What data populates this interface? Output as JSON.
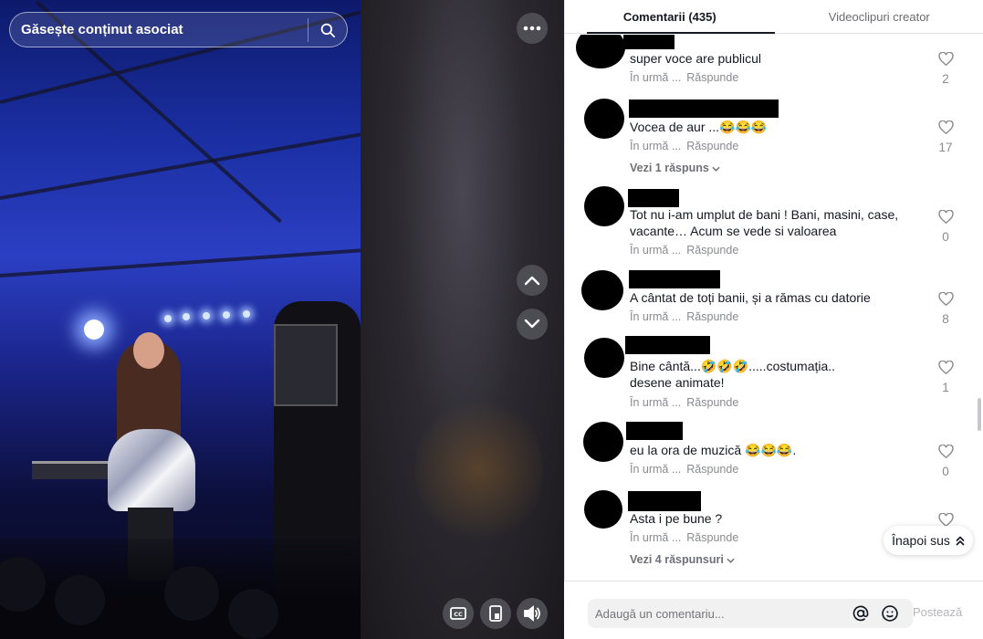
{
  "search": {
    "placeholder": "Găsește conținut asociat",
    "icon": "search-icon"
  },
  "video_controls": {
    "more_icon": "more-horizontal-icon",
    "previous_icon": "chevron-up-icon",
    "next_icon": "chevron-down-icon",
    "captions_icon": "captions-icon",
    "miniplayer_icon": "floating-player-icon",
    "volume_icon": "volume-icon"
  },
  "tabs": {
    "comments": "Comentarii (435)",
    "creator_videos": "Videoclipuri creator"
  },
  "comments": [
    {
      "text": "super voce are publicul ",
      "time": "În urmă ...",
      "reply": "Răspunde",
      "likes": "2",
      "replies": ""
    },
    {
      "text": "Vocea de aur ...😂😂😂",
      "time": "În urmă ...",
      "reply": "Răspunde",
      "likes": "17",
      "replies": "Vezi 1 răspuns"
    },
    {
      "text": "Tot nu i-am umplut de bani ! Bani, masini, case, vacante… Acum se vede si valoarea",
      "time": "În urmă ...",
      "reply": "Răspunde",
      "likes": "0",
      "replies": ""
    },
    {
      "text": "A cântat de toți banii, și a rămas cu datorie",
      "time": "În urmă ...",
      "reply": "Răspunde",
      "likes": "8",
      "replies": ""
    },
    {
      "text": "Bine cântă...🤣🤣🤣.....costumația.. desene animate!",
      "time": "În urmă ...",
      "reply": "Răspunde",
      "likes": "1",
      "replies": ""
    },
    {
      "text": "eu la ora de muzică 😂😂😂.",
      "time": "În urmă ...",
      "reply": "Răspunde",
      "likes": "0",
      "replies": ""
    },
    {
      "text": "Asta i pe bune ?",
      "time": "În urmă ...",
      "reply": "Răspunde",
      "likes": "",
      "replies": "Vezi 4 răspunsuri"
    }
  ],
  "back_to_top": "Înapoi sus",
  "comment_bar": {
    "placeholder": "Adaugă un comentariu...",
    "post": "Postează",
    "mention_icon": "at-icon",
    "emoji_icon": "emoji-icon"
  },
  "colors": {
    "text": "#161823",
    "muted": "#8a8b91",
    "post_disabled": "#b4b5ba",
    "video_overlay_button": "#54545a"
  }
}
